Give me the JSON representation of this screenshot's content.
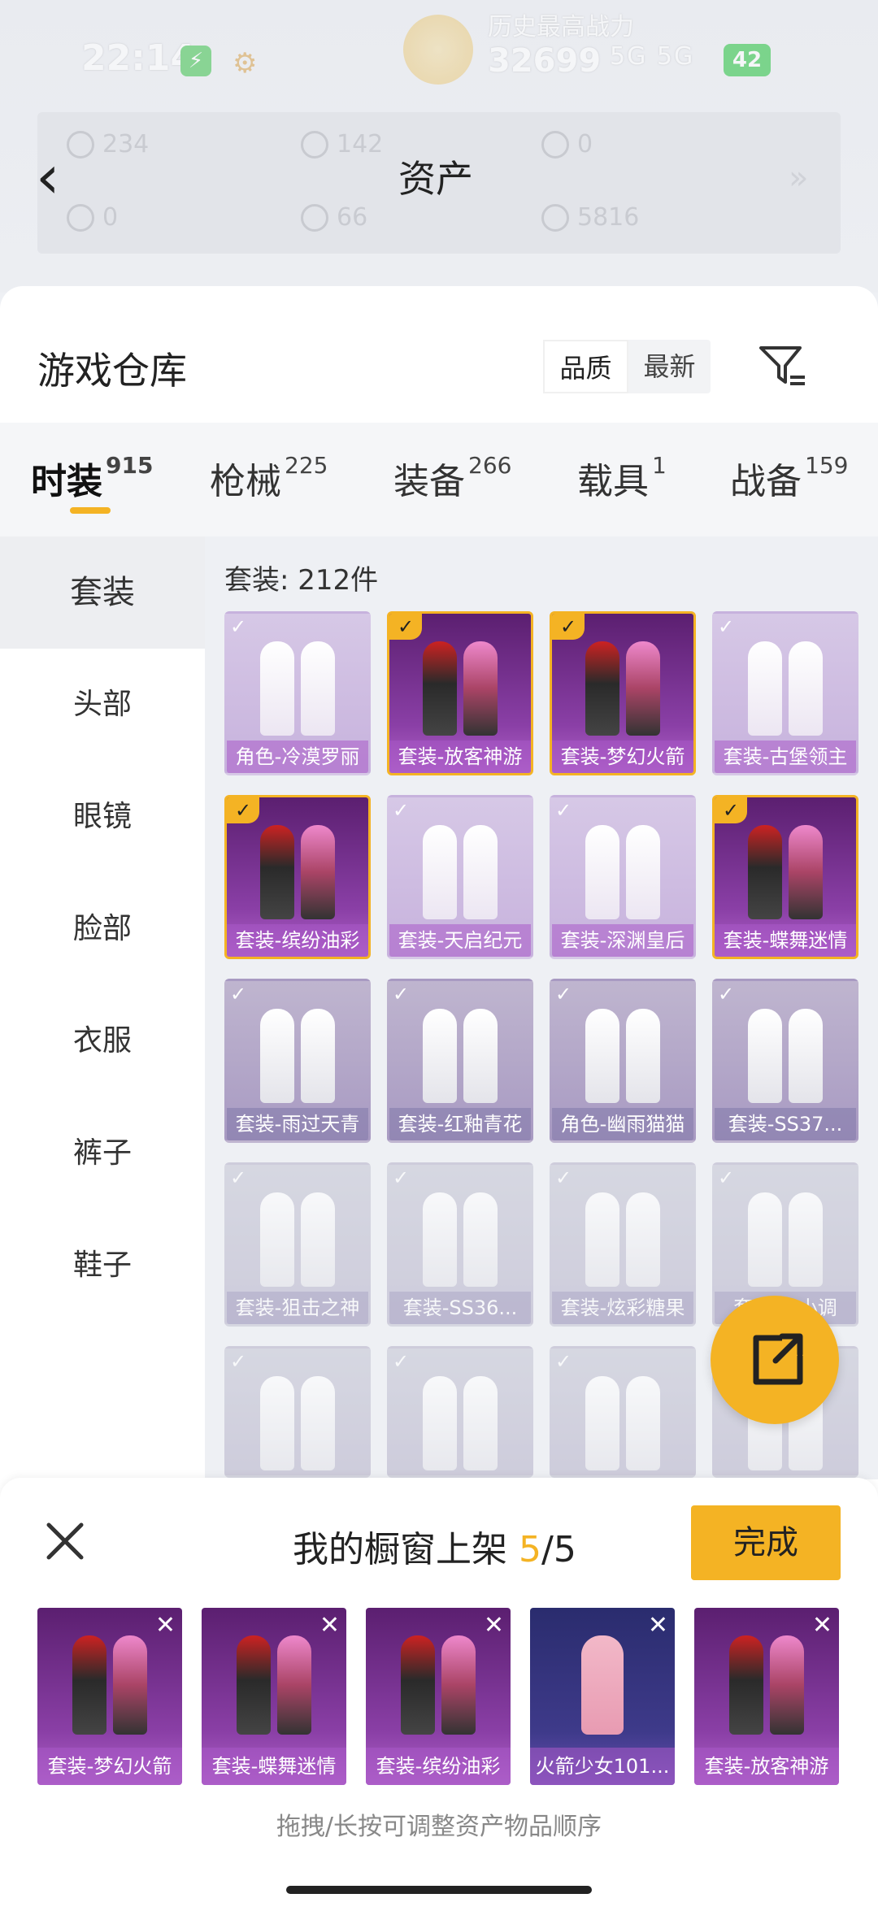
{
  "status": {
    "time": "22:14",
    "history_label": "历史最高战力",
    "score": "32699",
    "signal": "5G 5G",
    "battery": "42"
  },
  "assets": {
    "title": "资产",
    "items": [
      {
        "value": "234"
      },
      {
        "value": "142"
      },
      {
        "value": "0"
      },
      {
        "value": "0"
      },
      {
        "value": "66"
      },
      {
        "value": "5816"
      }
    ]
  },
  "warehouse": {
    "title": "游戏仓库",
    "sort_options": [
      "品质",
      "最新"
    ],
    "sort_active": "品质"
  },
  "tabs": [
    {
      "label": "时装",
      "count": "915"
    },
    {
      "label": "枪械",
      "count": "225"
    },
    {
      "label": "装备",
      "count": "266"
    },
    {
      "label": "载具",
      "count": "1"
    },
    {
      "label": "战备",
      "count": "159"
    }
  ],
  "categories": [
    "套装",
    "头部",
    "眼镜",
    "脸部",
    "衣服",
    "裤子",
    "鞋子"
  ],
  "grid": {
    "count_label": "套装: 212件",
    "items": [
      {
        "label": "角色-冷漠罗丽",
        "style": "light",
        "selected": false
      },
      {
        "label": "套装-放客神游",
        "style": "purple",
        "selected": true
      },
      {
        "label": "套装-梦幻火箭",
        "style": "purple",
        "selected": true
      },
      {
        "label": "套装-古堡领主",
        "style": "light",
        "selected": false
      },
      {
        "label": "套装-缤纷油彩",
        "style": "purple",
        "selected": true
      },
      {
        "label": "套装-天启纪元",
        "style": "light",
        "selected": false
      },
      {
        "label": "套装-深渊皇后",
        "style": "light",
        "selected": false
      },
      {
        "label": "套装-蝶舞迷情",
        "style": "purple",
        "selected": true
      },
      {
        "label": "套装-雨过天青",
        "style": "lilac",
        "selected": false
      },
      {
        "label": "套装-红釉青花",
        "style": "lilac",
        "selected": false
      },
      {
        "label": "角色-幽雨猫猫",
        "style": "lilac",
        "selected": false
      },
      {
        "label": "套装-SS37...",
        "style": "lilac",
        "selected": false
      },
      {
        "label": "套装-狙击之神",
        "style": "grey",
        "selected": false
      },
      {
        "label": "套装-SS36...",
        "style": "grey",
        "selected": false
      },
      {
        "label": "套装-炫彩糖果",
        "style": "grey",
        "selected": false
      },
      {
        "label": "套装-...小调",
        "style": "grey",
        "selected": false
      },
      {
        "label": "",
        "style": "grey",
        "selected": false
      },
      {
        "label": "",
        "style": "grey",
        "selected": false
      },
      {
        "label": "",
        "style": "grey",
        "selected": false
      },
      {
        "label": "",
        "style": "grey",
        "selected": false
      }
    ]
  },
  "showcase": {
    "title": "我的橱窗上架",
    "current": "5",
    "total": "/5",
    "done_label": "完成",
    "items": [
      {
        "label": "套装-梦幻火箭",
        "style": "purple"
      },
      {
        "label": "套装-蝶舞迷情",
        "style": "purple"
      },
      {
        "label": "套装-缤纷油彩",
        "style": "purple"
      },
      {
        "label": "火箭少女101...",
        "style": "navy"
      },
      {
        "label": "套装-放客神游",
        "style": "purple"
      }
    ],
    "hint": "拖拽/长按可调整资产物品顺序"
  },
  "colors": {
    "accent": "#f4b324",
    "card_purple": "#8a3fa6"
  }
}
